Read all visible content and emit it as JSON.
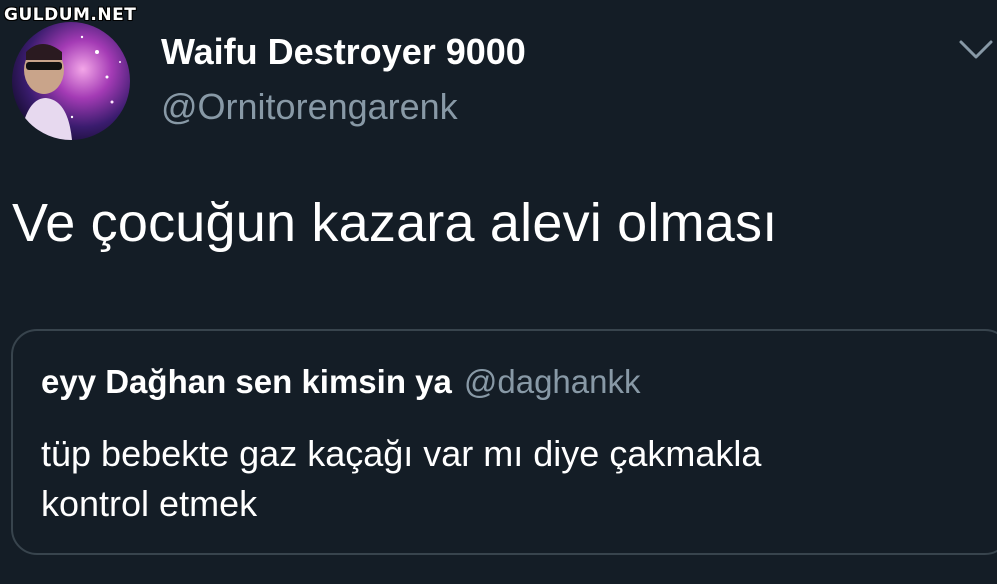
{
  "watermark": {
    "text": "GULDUM.NET"
  },
  "author": {
    "display_name": "Waifu Destroyer 9000",
    "handle": "@Ornitorengarenk",
    "avatar_icon": "galaxy-avatar"
  },
  "tweet": {
    "text": "Ve çocuğun kazara alevi olması",
    "menu_icon": "chevron-down-icon"
  },
  "quoted_tweet": {
    "display_name": "eyy Dağhan sen kimsin ya",
    "handle": "@daghankk",
    "lines": [
      "tüp bebekte gaz kaçağı var mı diye çakmakla",
      "kontrol etmek"
    ]
  },
  "colors": {
    "background": "#141d26",
    "primary_text": "#ffffff",
    "secondary_text": "#8899a6",
    "border": "#38444d"
  }
}
